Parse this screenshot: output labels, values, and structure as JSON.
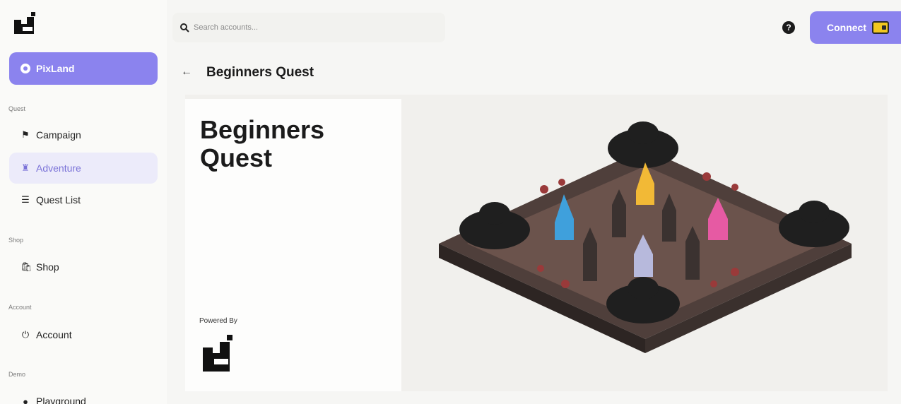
{
  "search": {
    "placeholder": "Search accounts..."
  },
  "header": {
    "title": "Beginners Quest",
    "connect_label": "Connect",
    "help_glyph": "?"
  },
  "sidebar": {
    "primary": {
      "label": "PixLand",
      "icon": "circle-icon"
    },
    "sections": [
      {
        "label": "Quest",
        "items": [
          {
            "label": "Campaign",
            "icon": "flag-icon"
          },
          {
            "label": "Adventure",
            "icon": "adventure-icon",
            "active": true
          },
          {
            "label": "Quest List",
            "icon": "list-icon"
          }
        ]
      },
      {
        "label": "Shop",
        "items": [
          {
            "label": "Shop",
            "icon": "bag-icon"
          }
        ]
      },
      {
        "label": "Account",
        "items": [
          {
            "label": "Account",
            "icon": "power-icon"
          }
        ]
      },
      {
        "label": "Demo",
        "items": [
          {
            "label": "Playground",
            "icon": "circle-icon"
          }
        ]
      }
    ]
  },
  "quest": {
    "title": "Beginners Quest",
    "powered_by": "Powered By"
  },
  "colors": {
    "accent": "#8b83ee",
    "active_bg": "#ecebfa",
    "wallet": "#f2c71e"
  }
}
